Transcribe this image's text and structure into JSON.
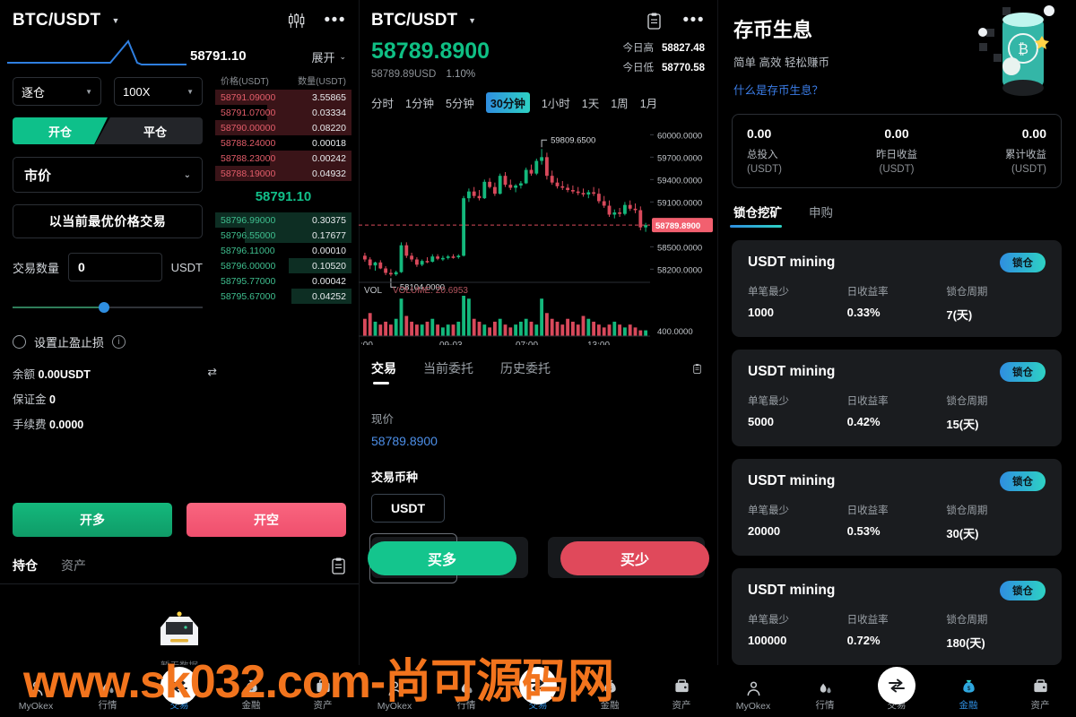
{
  "left": {
    "pair": "BTC/USDT",
    "caret_icon": "chevron-down-icon",
    "candle_icon": "candlestick-settings-icon",
    "more_icon": "more-dots-icon",
    "spark_price": "58791.10",
    "expand_label": "展开",
    "margin_mode": "逐仓",
    "leverage": "100X",
    "seg_open": "开仓",
    "seg_close": "平仓",
    "order_type": "市价",
    "best_price_label": "以当前最优价格交易",
    "qty_label": "交易数量",
    "qty_value": "0",
    "qty_unit": "USDT",
    "tp_sl_label": "设置止盈止损",
    "balance_key": "余额",
    "balance_value": "0.00USDT",
    "margin_key": "保证金",
    "margin_value": "0",
    "fee_key": "手续费",
    "fee_value": "0.0000",
    "btn_long": "开多",
    "btn_short": "开空",
    "tab_positions": "持仓",
    "tab_assets": "资产",
    "empty_text": "暂无数据",
    "orderbook": {
      "head_price": "价格(USDT)",
      "head_qty": "数量(USDT)",
      "mid_price": "58791.10",
      "asks": [
        {
          "price": "58791.09000",
          "qty": "3.55865",
          "depth": 100
        },
        {
          "price": "58791.07000",
          "qty": "0.03334",
          "depth": 62
        },
        {
          "price": "58790.00000",
          "qty": "0.08220",
          "depth": 100
        },
        {
          "price": "58788.24000",
          "qty": "0.00018",
          "depth": 0
        },
        {
          "price": "58788.23000",
          "qty": "0.00242",
          "depth": 60
        },
        {
          "price": "58788.19000",
          "qty": "0.04932",
          "depth": 100
        }
      ],
      "bids": [
        {
          "price": "58796.99000",
          "qty": "0.30375",
          "depth": 100
        },
        {
          "price": "58796.55000",
          "qty": "0.17677",
          "depth": 78
        },
        {
          "price": "58796.11000",
          "qty": "0.00010",
          "depth": 0
        },
        {
          "price": "58796.00000",
          "qty": "0.10520",
          "depth": 46
        },
        {
          "price": "58795.77000",
          "qty": "0.00042",
          "depth": 0
        },
        {
          "price": "58795.67000",
          "qty": "0.04252",
          "depth": 44
        }
      ]
    }
  },
  "middle": {
    "pair": "BTC/USDT",
    "note_icon": "clipboard-icon",
    "more_icon": "more-dots-icon",
    "price": "58789.8900",
    "price_usd": "58789.89USD",
    "change_pct": "1.10%",
    "high_key": "今日高",
    "high_value": "58827.48",
    "low_key": "今日低",
    "low_value": "58770.58",
    "timeframes": [
      "分时",
      "1分钟",
      "5分钟",
      "30分钟",
      "1小时",
      "1天",
      "1周",
      "1月"
    ],
    "active_timeframe": "30分钟",
    "tabs": [
      "交易",
      "当前委托",
      "历史委托"
    ],
    "active_tab": "交易",
    "now_key": "现价",
    "now_value": "58789.8900",
    "currency_key": "交易币种",
    "currency_value": "USDT",
    "btn_buy": "买多",
    "btn_sell": "买少"
  },
  "right": {
    "title": "存币生息",
    "subtitle": "简单 高效 轻松赚币",
    "link": "什么是存币生息？",
    "stats": [
      {
        "value": "0.00",
        "key": "总投入",
        "unit": "(USDT)"
      },
      {
        "value": "0.00",
        "key": "昨日收益",
        "unit": "(USDT)"
      },
      {
        "value": "0.00",
        "key": "累计收益",
        "unit": "(USDT)"
      }
    ],
    "tabs": [
      "锁仓挖矿",
      "申购"
    ],
    "active_tab": "锁仓挖矿",
    "col_min": "单笔最少",
    "col_rate": "日收益率",
    "col_period": "锁仓周期",
    "badge": "锁仓",
    "cards": [
      {
        "title": "USDT mining",
        "min": "1000",
        "rate": "0.33%",
        "period": "7(天)"
      },
      {
        "title": "USDT mining",
        "min": "5000",
        "rate": "0.42%",
        "period": "15(天)"
      },
      {
        "title": "USDT mining",
        "min": "20000",
        "rate": "0.53%",
        "period": "30(天)"
      },
      {
        "title": "USDT mining",
        "min": "100000",
        "rate": "0.72%",
        "period": "180(天)"
      }
    ]
  },
  "navbar": {
    "items": [
      {
        "label": "MyOkex",
        "icon": "person-icon"
      },
      {
        "label": "行情",
        "icon": "market-icon"
      },
      {
        "label": "交易",
        "icon": "exchange-arrows-icon"
      },
      {
        "label": "金融",
        "icon": "money-bag-icon"
      },
      {
        "label": "资产",
        "icon": "wallet-icon"
      }
    ],
    "active_left": "交易",
    "active_right": "金融"
  },
  "watermark": "www.sk032.com-尚可源码网",
  "chart_data": {
    "type": "candlestick",
    "title": "BTC/USDT 30分钟",
    "high_annotation": "59809.6500",
    "low_annotation": "58104.0000",
    "current_price_tag": "58789.8900",
    "volume_label": "VOL",
    "volume_value": "VOLUME: 20.6953",
    "y_ticks": [
      "60000.0000",
      "59700.0000",
      "59400.0000",
      "59100.0000",
      "58500.0000",
      "58200.0000"
    ],
    "volume_tick": "400.0000",
    "x_ticks": [
      ":00",
      "09-03",
      "07:00",
      "13:00"
    ],
    "ylim": [
      58000,
      60100
    ],
    "grid": false,
    "ohlc": [
      [
        58380,
        58420,
        58300,
        58330
      ],
      [
        58330,
        58360,
        58200,
        58250
      ],
      [
        58250,
        58300,
        58180,
        58290
      ],
      [
        58290,
        58320,
        58200,
        58210
      ],
      [
        58210,
        58240,
        58120,
        58150
      ],
      [
        58150,
        58200,
        58104,
        58130
      ],
      [
        58130,
        58180,
        58110,
        58160
      ],
      [
        58160,
        58560,
        58150,
        58520
      ],
      [
        58520,
        58560,
        58350,
        58380
      ],
      [
        58380,
        58420,
        58300,
        58330
      ],
      [
        58330,
        58360,
        58230,
        58260
      ],
      [
        58260,
        58330,
        58240,
        58310
      ],
      [
        58310,
        58360,
        58280,
        58300
      ],
      [
        58300,
        58400,
        58290,
        58370
      ],
      [
        58370,
        58400,
        58320,
        58340
      ],
      [
        58340,
        58380,
        58310,
        58350
      ],
      [
        58350,
        58390,
        58330,
        58370
      ],
      [
        58370,
        58400,
        58340,
        58360
      ],
      [
        58360,
        58400,
        58340,
        58380
      ],
      [
        58380,
        59180,
        58370,
        59150
      ],
      [
        59150,
        59280,
        59100,
        59240
      ],
      [
        59240,
        59300,
        59150,
        59180
      ],
      [
        59180,
        59260,
        59120,
        59150
      ],
      [
        59150,
        59400,
        59140,
        59370
      ],
      [
        59370,
        59420,
        59280,
        59300
      ],
      [
        59300,
        59360,
        59180,
        59210
      ],
      [
        59210,
        59480,
        59200,
        59450
      ],
      [
        59450,
        59500,
        59300,
        59330
      ],
      [
        59330,
        59400,
        59260,
        59290
      ],
      [
        59290,
        59340,
        59230,
        59320
      ],
      [
        59320,
        59380,
        59280,
        59350
      ],
      [
        59350,
        59560,
        59340,
        59530
      ],
      [
        59530,
        59600,
        59450,
        59480
      ],
      [
        59480,
        59680,
        59460,
        59650
      ],
      [
        59650,
        59809,
        59600,
        59700
      ],
      [
        59700,
        59760,
        59400,
        59450
      ],
      [
        59450,
        59520,
        59330,
        59360
      ],
      [
        59360,
        59420,
        59280,
        59310
      ],
      [
        59310,
        59380,
        59260,
        59290
      ],
      [
        59290,
        59340,
        59230,
        59260
      ],
      [
        59260,
        59320,
        59210,
        59240
      ],
      [
        59240,
        59300,
        59190,
        59220
      ],
      [
        59220,
        59280,
        59170,
        59200
      ],
      [
        59200,
        59260,
        59150,
        59230
      ],
      [
        59230,
        59300,
        59180,
        59210
      ],
      [
        59210,
        59280,
        59080,
        59110
      ],
      [
        59110,
        59180,
        59020,
        59050
      ],
      [
        59050,
        59120,
        58900,
        58930
      ],
      [
        58930,
        59000,
        58880,
        58960
      ],
      [
        58960,
        59020,
        58900,
        58940
      ],
      [
        58940,
        59100,
        58920,
        59060
      ],
      [
        59060,
        59120,
        58980,
        59010
      ],
      [
        59010,
        59080,
        58950,
        58990
      ],
      [
        58990,
        59040,
        58720,
        58760
      ],
      [
        58760,
        58820,
        58700,
        58790
      ]
    ],
    "volumes": [
      6,
      8,
      5,
      4,
      5,
      4,
      6,
      13,
      7,
      5,
      4,
      4,
      5,
      6,
      4,
      3,
      4,
      4,
      5,
      14,
      13,
      6,
      5,
      4,
      3,
      5,
      6,
      4,
      3,
      4,
      5,
      6,
      5,
      4,
      13,
      8,
      6,
      5,
      4,
      6,
      5,
      4,
      7,
      6,
      5,
      4,
      3,
      4,
      5,
      4,
      3,
      4,
      3,
      2,
      2
    ]
  }
}
